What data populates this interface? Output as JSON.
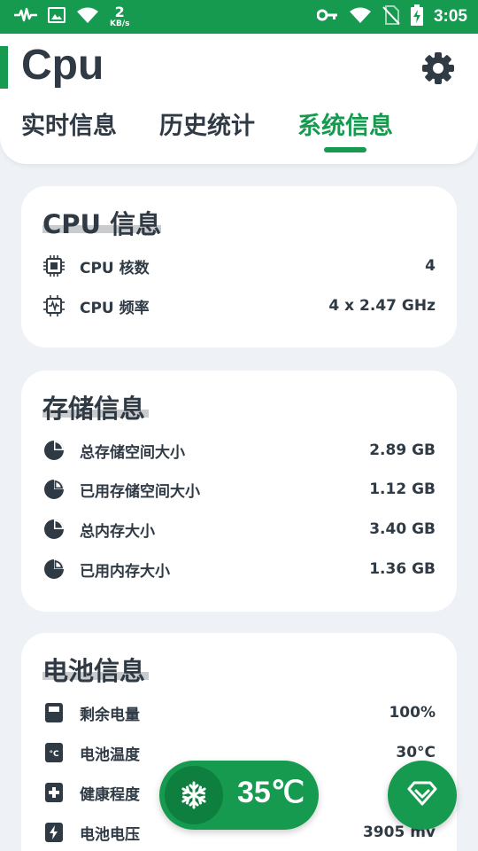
{
  "status_bar": {
    "net_speed_value": "2",
    "net_speed_unit": "KB/s",
    "time": "3:05"
  },
  "header": {
    "title": "Cpu",
    "tabs": [
      {
        "label": "实时信息",
        "active": false
      },
      {
        "label": "历史统计",
        "active": false
      },
      {
        "label": "系统信息",
        "active": true
      }
    ]
  },
  "cpu_card": {
    "title": "CPU 信息",
    "rows": [
      {
        "icon": "cpu-chip-icon",
        "label": "CPU 核数",
        "value": "4"
      },
      {
        "icon": "cpu-frequency-icon",
        "label": "CPU 频率",
        "value": "4 x 2.47 GHz"
      }
    ]
  },
  "storage_card": {
    "title": "存储信息",
    "rows": [
      {
        "icon": "pie-chart-icon",
        "label": "总存储空间大小",
        "value": "2.89 GB"
      },
      {
        "icon": "pie-chart-icon",
        "label": "已用存储空间大小",
        "value": "1.12 GB"
      },
      {
        "icon": "pie-chart-icon",
        "label": "总内存大小",
        "value": "3.40 GB"
      },
      {
        "icon": "pie-chart-icon",
        "label": "已用内存大小",
        "value": "1.36 GB"
      }
    ]
  },
  "battery_card": {
    "title": "电池信息",
    "rows": [
      {
        "icon": "battery-level-icon",
        "label": "剩余电量",
        "value": "100%"
      },
      {
        "icon": "battery-temperature-icon",
        "label": "电池温度",
        "value": "30°C"
      },
      {
        "icon": "battery-health-icon",
        "label": "健康程度",
        "value": ""
      },
      {
        "icon": "battery-voltage-icon",
        "label": "电池电压",
        "value": "3905 mv"
      }
    ]
  },
  "cooling_widget": {
    "temperature": "35℃"
  },
  "colors": {
    "accent": "#159a4f",
    "text": "#2f3a45",
    "background": "#eef1f5"
  }
}
